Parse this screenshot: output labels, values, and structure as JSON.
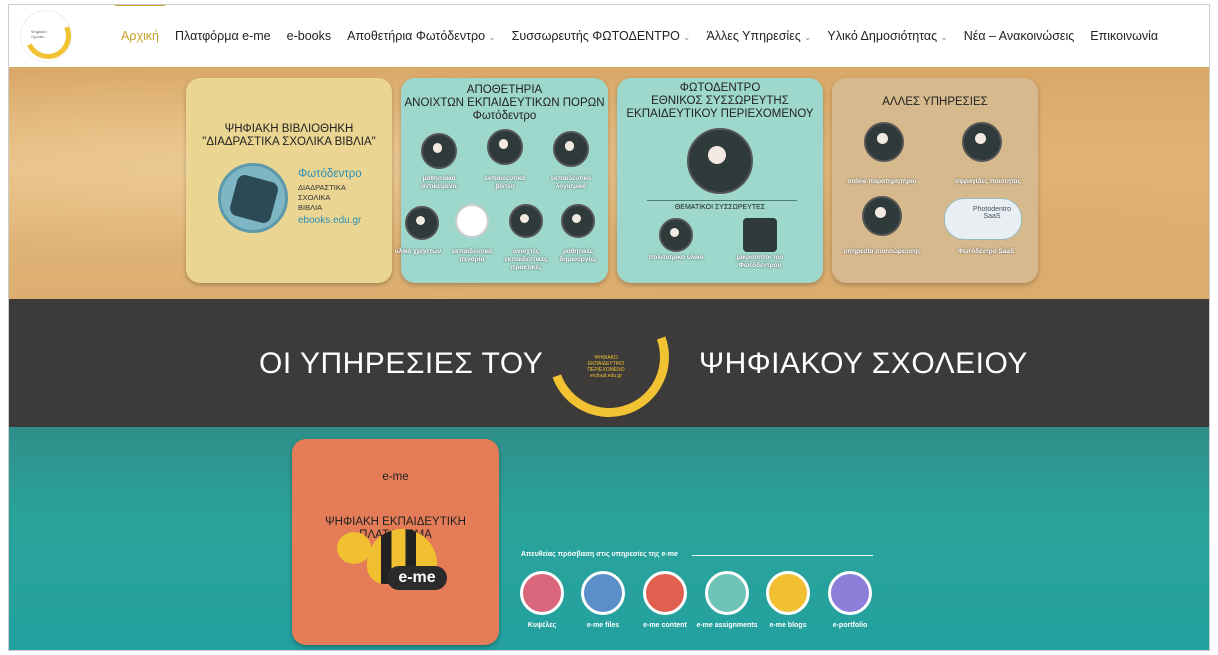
{
  "nav": {
    "logo_text": "Ψηφιακό Σχολείο",
    "items": [
      {
        "label": "Αρχική",
        "dropdown": false
      },
      {
        "label": "Πλατφόρμα e-me",
        "dropdown": false
      },
      {
        "label": "e-books",
        "dropdown": false
      },
      {
        "label": "Αποθετήρια Φωτόδεντρο",
        "dropdown": true
      },
      {
        "label": "Συσσωρευτής ΦΩΤΟΔΕΝΤΡΟ",
        "dropdown": true
      },
      {
        "label": "Άλλες Υπηρεσίες",
        "dropdown": true
      },
      {
        "label": "Υλικό Δημοσιότητας",
        "dropdown": true
      },
      {
        "label": "Νέα – Ανακοινώσεις",
        "dropdown": false
      },
      {
        "label": "Επικοινωνία",
        "dropdown": false
      }
    ],
    "active_color": "#c9a227"
  },
  "cards": {
    "library": {
      "title_line1": "ΨΗΦΙΑΚΗ ΒΙΒΛΙΟΘΗΚΗ",
      "title_line2": "\"ΔΙΑΔΡΑΣΤΙΚΑ ΣΧΟΛΙΚΑ ΒΙΒΛΙΑ\"",
      "brand": "Φωτόδεντρο",
      "sub1": "ΔΙΑΔΡΑΣΤΙΚΑ",
      "sub2": "ΣΧΟΛΙΚΑ",
      "sub3": "ΒΙΒΛΙΑ",
      "domain": "ebooks.edu.gr"
    },
    "repositories": {
      "title_line1": "ΑΠΟΘΕΤΗΡΙΑ",
      "title_line2": "ΑΝΟΙΧΤΩΝ ΕΚΠΑΙΔΕΥΤΙΚΩΝ ΠΟΡΩΝ",
      "title_line3": "Φωτόδεντρο",
      "items": [
        "μαθησιακά αντικείμενα",
        "εκπαιδευτικά βίντεο",
        "εκπαιδευτικό λογισμικό",
        "υλικό χρηστών",
        "εκπαιδευτικά σενάρια",
        "ανοιχτές εκπαιδευτικές πρακτικές",
        "μαθητικές δημιουργίες"
      ]
    },
    "aggregator": {
      "title_line1": "ΦΩΤΟΔΕΝΤΡΟ",
      "title_line2": "ΕΘΝΙΚΟΣ ΣΥΣΣΩΡΕΥΤΗΣ",
      "title_line3": "ΕΚΠΑΙΔΕΥΤΙΚΟΥ ΠΕΡΙΕΧΟΜΕΝΟΥ",
      "thematic": "ΘΕΜΑΤΙΚΟΙ ΣΥΣΣΩΡΕΥΤΕΣ",
      "items": [
        "πολιτισμικό υλικό",
        "μικρότοποι του Φωτόδεντρου"
      ]
    },
    "other": {
      "title": "ΑΛΛΕΣ ΥΠΗΡΕΣΙΕΣ",
      "items": [
        "online παρατηρητήριο",
        "σφραγίδες ποιότητας",
        "υπηρεσία συσσώρευσης",
        "Φωτόδεντρο SaaS"
      ],
      "saas_label": "Photodentro SaaS"
    }
  },
  "band": {
    "left": "ΟΙ ΥΠΗΡΕΣΙΕΣ ΤΟΥ",
    "right": "ΨΗΦΙΑΚΟΥ ΣΧΟΛΕΙΟΥ",
    "logo_lines": [
      "ΨΗΦΙΑΚΟ",
      "ΕΚΠΑΙΔΕΥΤΙΚΟ",
      "ΠΕΡΙΕΧΟΜΕΝΟ",
      "ercloud.edu.gr"
    ]
  },
  "eme": {
    "title_line1": "e-me",
    "title_line2": "ΨΗΦΙΑΚΗ ΕΚΠΑΙΔΕΥΤΙΚΗ ΠΛΑΤΦΟΡΜΑ",
    "logo_text": "e-me",
    "direct_access": "Απευθείας πρόσβαση στις υπηρεσίες της e-me",
    "services": [
      {
        "label": "Κυψέλες",
        "color": "#d9667a"
      },
      {
        "label": "e-me files",
        "color": "#5b8fc9"
      },
      {
        "label": "e-me content",
        "color": "#e0604f"
      },
      {
        "label": "e-me assignments",
        "color": "#6fc4b8"
      },
      {
        "label": "e-me blogs",
        "color": "#f0c030"
      },
      {
        "label": "e-portfolio",
        "color": "#8c7fd9"
      }
    ],
    "blogs_badge": "e-me blogs"
  }
}
